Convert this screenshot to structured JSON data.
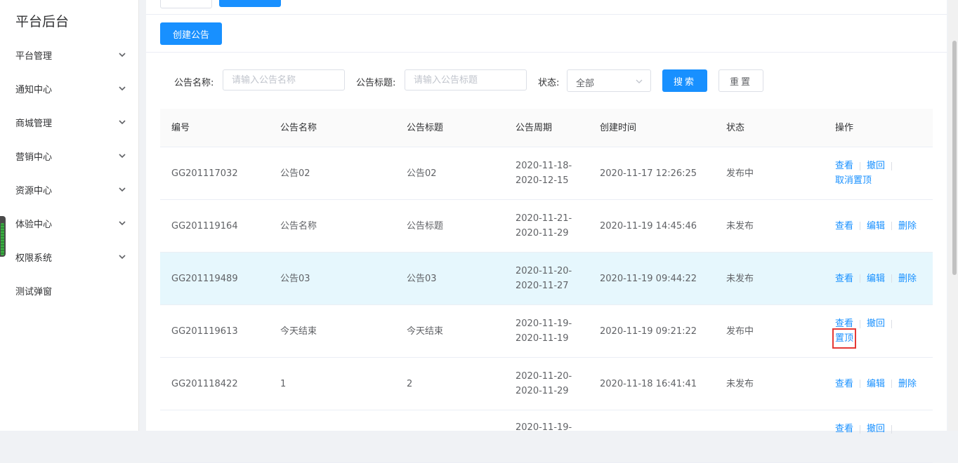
{
  "sidebar": {
    "brand": "平台后台",
    "items": [
      {
        "label": "平台管理",
        "has_arrow": true
      },
      {
        "label": "通知中心",
        "has_arrow": true
      },
      {
        "label": "商城管理",
        "has_arrow": true
      },
      {
        "label": "营销中心",
        "has_arrow": true
      },
      {
        "label": "资源中心",
        "has_arrow": true
      },
      {
        "label": "体验中心",
        "has_arrow": true
      },
      {
        "label": "权限系统",
        "has_arrow": true
      },
      {
        "label": "测试弹窗",
        "has_arrow": false
      }
    ]
  },
  "toolbar": {
    "create_label": "创建公告"
  },
  "filters": {
    "name_label": "公告名称:",
    "name_placeholder": "请输入公告名称",
    "title_label": "公告标题:",
    "title_placeholder": "请输入公告标题",
    "status_label": "状态:",
    "status_value": "全部",
    "search_label": "搜索",
    "reset_label": "重置"
  },
  "table": {
    "columns": [
      "编号",
      "公告名称",
      "公告标题",
      "公告周期",
      "创建时间",
      "状态",
      "操作"
    ],
    "rows": [
      {
        "id": "GG201117032",
        "name": "公告02",
        "title": "公告02",
        "period_start": "2020-11-18-",
        "period_end": "2020-12-15",
        "created": "2020-11-17 12:26:25",
        "status": "发布中",
        "ops": [
          [
            "查看",
            "撤回"
          ],
          [
            "取消置顶"
          ]
        ]
      },
      {
        "id": "GG201119164",
        "name": "公告名称",
        "title": "公告标题",
        "period_start": "2020-11-21-",
        "period_end": "2020-11-29",
        "created": "2020-11-19 14:45:46",
        "status": "未发布",
        "ops": [
          [
            "查看",
            "编辑",
            "删除"
          ]
        ]
      },
      {
        "id": "GG201119489",
        "name": "公告03",
        "title": "公告03",
        "period_start": "2020-11-20-",
        "period_end": "2020-11-27",
        "created": "2020-11-19 09:44:22",
        "status": "未发布",
        "ops": [
          [
            "查看",
            "编辑",
            "删除"
          ]
        ]
      },
      {
        "id": "GG201119613",
        "name": "今天结束",
        "title": "今天结束",
        "period_start": "2020-11-19-",
        "period_end": "2020-11-19",
        "created": "2020-11-19 09:21:22",
        "status": "发布中",
        "ops": [
          [
            "查看",
            "撤回"
          ],
          [
            "置顶"
          ]
        ]
      },
      {
        "id": "GG201118422",
        "name": "1",
        "title": "2",
        "period_start": "2020-11-20-",
        "period_end": "2020-11-29",
        "created": "2020-11-18 16:41:41",
        "status": "未发布",
        "ops": [
          [
            "查看",
            "编辑",
            "删除"
          ]
        ]
      },
      {
        "id": "",
        "name": "",
        "title": "",
        "period_start": "2020-11-19-",
        "period_end": "",
        "created": "",
        "status": "",
        "ops": [
          [
            "查看",
            "撤回"
          ]
        ]
      }
    ]
  },
  "colors": {
    "primary": "#1890ff",
    "highlight_row": "#e6f7fd",
    "annotation_box": "#e53935"
  }
}
